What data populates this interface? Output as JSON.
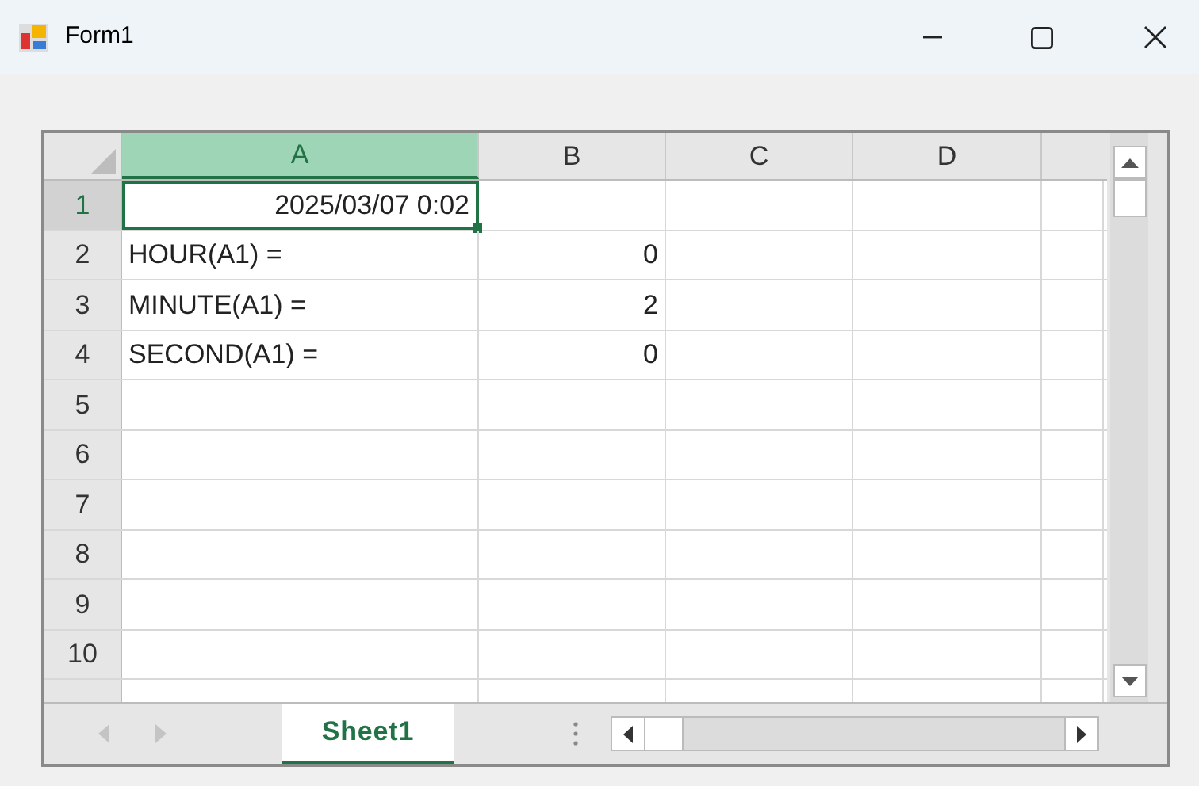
{
  "window": {
    "title": "Form1"
  },
  "columns": [
    {
      "label": "A",
      "selected": true
    },
    {
      "label": "B",
      "selected": false
    },
    {
      "label": "C",
      "selected": false
    },
    {
      "label": "D",
      "selected": false
    }
  ],
  "rows": [
    {
      "label": "1",
      "selected": true,
      "cells": [
        {
          "text": "2025/03/07 0:02",
          "kind": "number",
          "active": true
        }
      ]
    },
    {
      "label": "2",
      "selected": false,
      "cells": [
        {
          "text": "HOUR(A1) =",
          "kind": "text",
          "active": false
        },
        {
          "text": "0",
          "kind": "number",
          "active": false
        }
      ]
    },
    {
      "label": "3",
      "selected": false,
      "cells": [
        {
          "text": "MINUTE(A1) =",
          "kind": "text",
          "active": false
        },
        {
          "text": "2",
          "kind": "number",
          "active": false
        }
      ]
    },
    {
      "label": "4",
      "selected": false,
      "cells": [
        {
          "text": "SECOND(A1) =",
          "kind": "text",
          "active": false
        },
        {
          "text": "0",
          "kind": "number",
          "active": false
        }
      ]
    },
    {
      "label": "5",
      "selected": false,
      "cells": []
    },
    {
      "label": "6",
      "selected": false,
      "cells": []
    },
    {
      "label": "7",
      "selected": false,
      "cells": []
    },
    {
      "label": "8",
      "selected": false,
      "cells": []
    },
    {
      "label": "9",
      "selected": false,
      "cells": []
    },
    {
      "label": "10",
      "selected": false,
      "cells": []
    }
  ],
  "sheet_tabs": [
    {
      "label": "Sheet1",
      "selected": true
    }
  ]
}
